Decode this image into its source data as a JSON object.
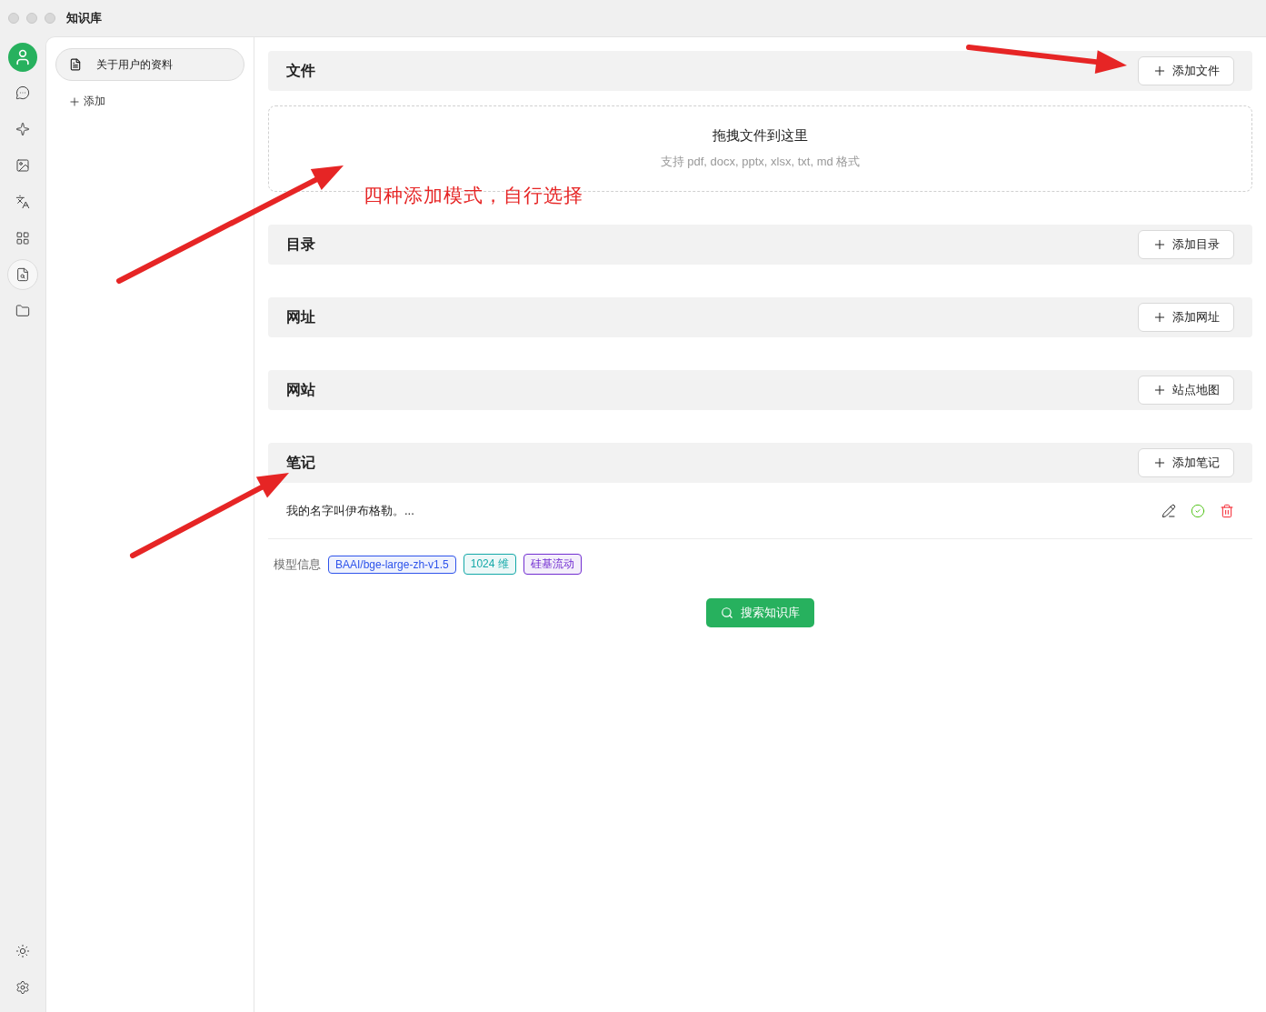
{
  "window": {
    "title": "知识库"
  },
  "rail": {
    "items": [
      {
        "kind": "chat",
        "selected": false
      },
      {
        "kind": "sparkle",
        "selected": false
      },
      {
        "kind": "image",
        "selected": false
      },
      {
        "kind": "translate",
        "selected": false
      },
      {
        "kind": "apps",
        "selected": false
      },
      {
        "kind": "knowledge",
        "selected": true
      },
      {
        "kind": "folder",
        "selected": false
      }
    ],
    "bottom": [
      {
        "kind": "theme"
      },
      {
        "kind": "settings"
      }
    ]
  },
  "bases": {
    "items": [
      {
        "label": "关于用户的资料",
        "selected": true
      }
    ],
    "add": "添加"
  },
  "sections": [
    {
      "kind": "files",
      "title": "文件",
      "button": "添加文件",
      "dropzone": {
        "title": "拖拽文件到这里",
        "hint": "支持 pdf, docx, pptx, xlsx, txt, md 格式"
      }
    },
    {
      "kind": "plain",
      "title": "目录",
      "button": "添加目录"
    },
    {
      "kind": "plain",
      "title": "网址",
      "button": "添加网址"
    },
    {
      "kind": "plain",
      "title": "网站",
      "button": "站点地图"
    },
    {
      "kind": "notes",
      "title": "笔记",
      "button": "添加笔记",
      "notes": [
        {
          "text": "我的名字叫伊布格勒。..."
        }
      ]
    }
  ],
  "model_info": {
    "label": "模型信息",
    "tags": [
      {
        "text": "BAAI/bge-large-zh-v1.5",
        "color": "#2f54eb"
      },
      {
        "text": "1024 维",
        "color": "#13a8a8"
      },
      {
        "text": "硅基流动",
        "color": "#722ed1"
      }
    ]
  },
  "search_button": "搜索知识库",
  "annotation": {
    "text": "四种添加模式，自行选择"
  }
}
